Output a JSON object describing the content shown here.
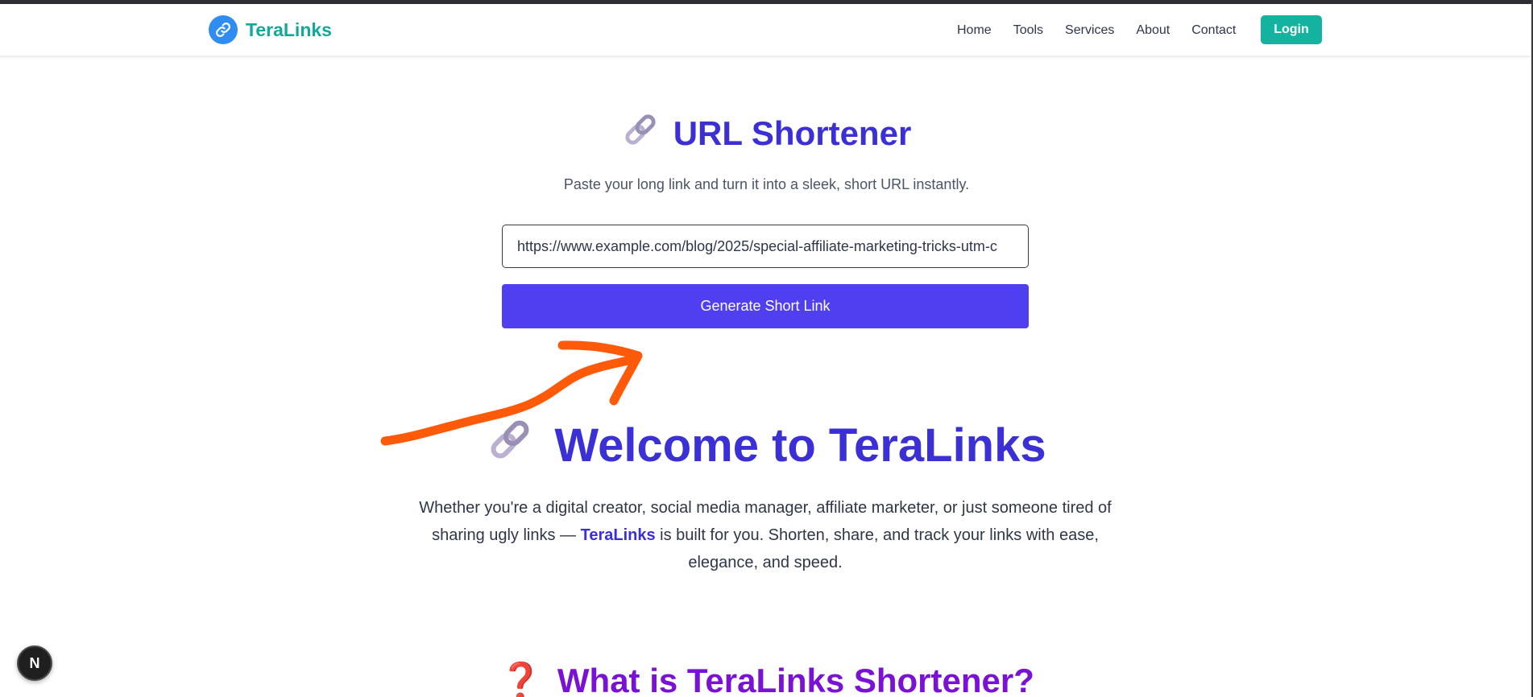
{
  "navbar": {
    "brand_name": "TeraLinks",
    "links": [
      "Home",
      "Tools",
      "Services",
      "About",
      "Contact"
    ],
    "login_label": "Login"
  },
  "hero": {
    "title": "URL Shortener",
    "subtitle": "Paste your long link and turn it into a sleek, short URL instantly.",
    "input_value": "https://www.example.com/blog/2025/special-affiliate-marketing-tricks-utm-c",
    "button_label": "Generate Short Link"
  },
  "welcome": {
    "title": "Welcome to TeraLinks",
    "text_before": "Whether you're a digital creator, social media manager, affiliate marketer, or just someone tired of sharing ugly links — ",
    "brand": "TeraLinks",
    "text_after": " is built for you. Shorten, share, and track your links with ease, elegance, and speed."
  },
  "what_is": {
    "title": "What is TeraLinks Shortener?"
  },
  "dev_badge": {
    "label": "N"
  },
  "colors": {
    "brand_teal": "#14a89a",
    "login_bg": "#13b3a0",
    "primary_purple": "#3b2fd6",
    "button_purple": "#4f3ff0",
    "what_is_purple": "#7a12d6",
    "annotation_orange": "#ff5a0a"
  },
  "icons": {
    "brand_logo": "link-icon",
    "hero_title": "chain-link-icon",
    "welcome_title": "chain-link-icon",
    "what_is_title": "question-mark-icon"
  }
}
